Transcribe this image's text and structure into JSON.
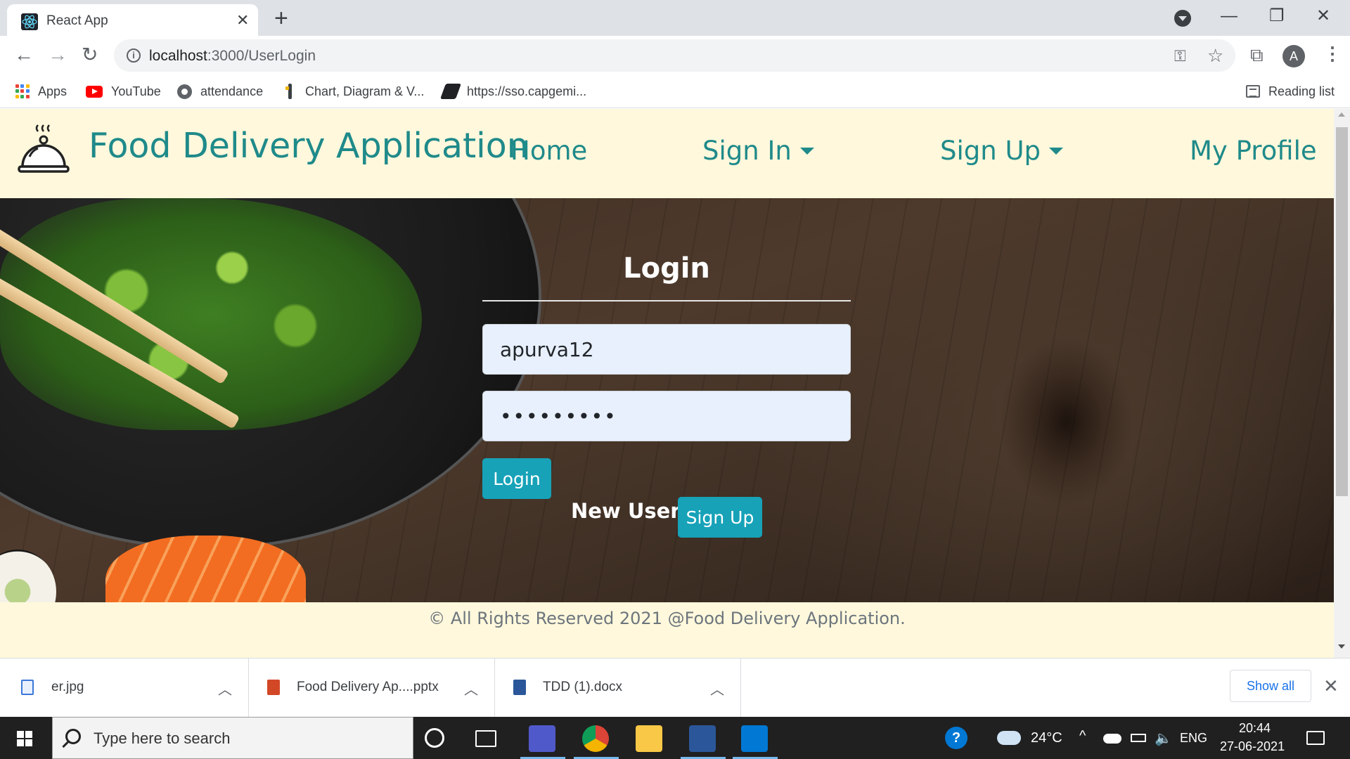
{
  "browser": {
    "tab_title": "React App",
    "url_host": "localhost",
    "url_path": ":3000/UserLogin",
    "bookmarks": [
      {
        "label": "Apps",
        "icon": "apps-grid-icon"
      },
      {
        "label": "YouTube",
        "icon": "youtube-icon"
      },
      {
        "label": "attendance",
        "icon": "globe-icon"
      },
      {
        "label": "Chart, Diagram & V...",
        "icon": "chart-icon"
      },
      {
        "label": "https://sso.capgemi...",
        "icon": "sso-icon"
      }
    ],
    "reading_list": "Reading list",
    "profile_initial": "A"
  },
  "app": {
    "brand": "Food Delivery Application",
    "nav": {
      "home": "Home",
      "sign_in": "Sign In",
      "sign_up": "Sign Up",
      "my_profile": "My Profile"
    },
    "login": {
      "title": "Login",
      "username_value": "apurva12",
      "password_value": "•••••••••",
      "login_button": "Login",
      "new_user": "New User?",
      "signup_button": "Sign Up"
    },
    "footer": "© All Rights Reserved 2021 @Food Delivery Application."
  },
  "downloads": {
    "items": [
      {
        "name": "er.jpg",
        "type": "image"
      },
      {
        "name": "Food Delivery Ap....pptx",
        "type": "powerpoint"
      },
      {
        "name": "TDD (1).docx",
        "type": "word"
      }
    ],
    "show_all": "Show all"
  },
  "taskbar": {
    "search_placeholder": "Type here to search",
    "weather": "24°C",
    "language": "ENG",
    "time": "20:44",
    "date": "27-06-2021"
  },
  "colors": {
    "accent": "#17a2b8",
    "brand_text": "#1f8a8a",
    "nav_background": "#fff8dc"
  }
}
